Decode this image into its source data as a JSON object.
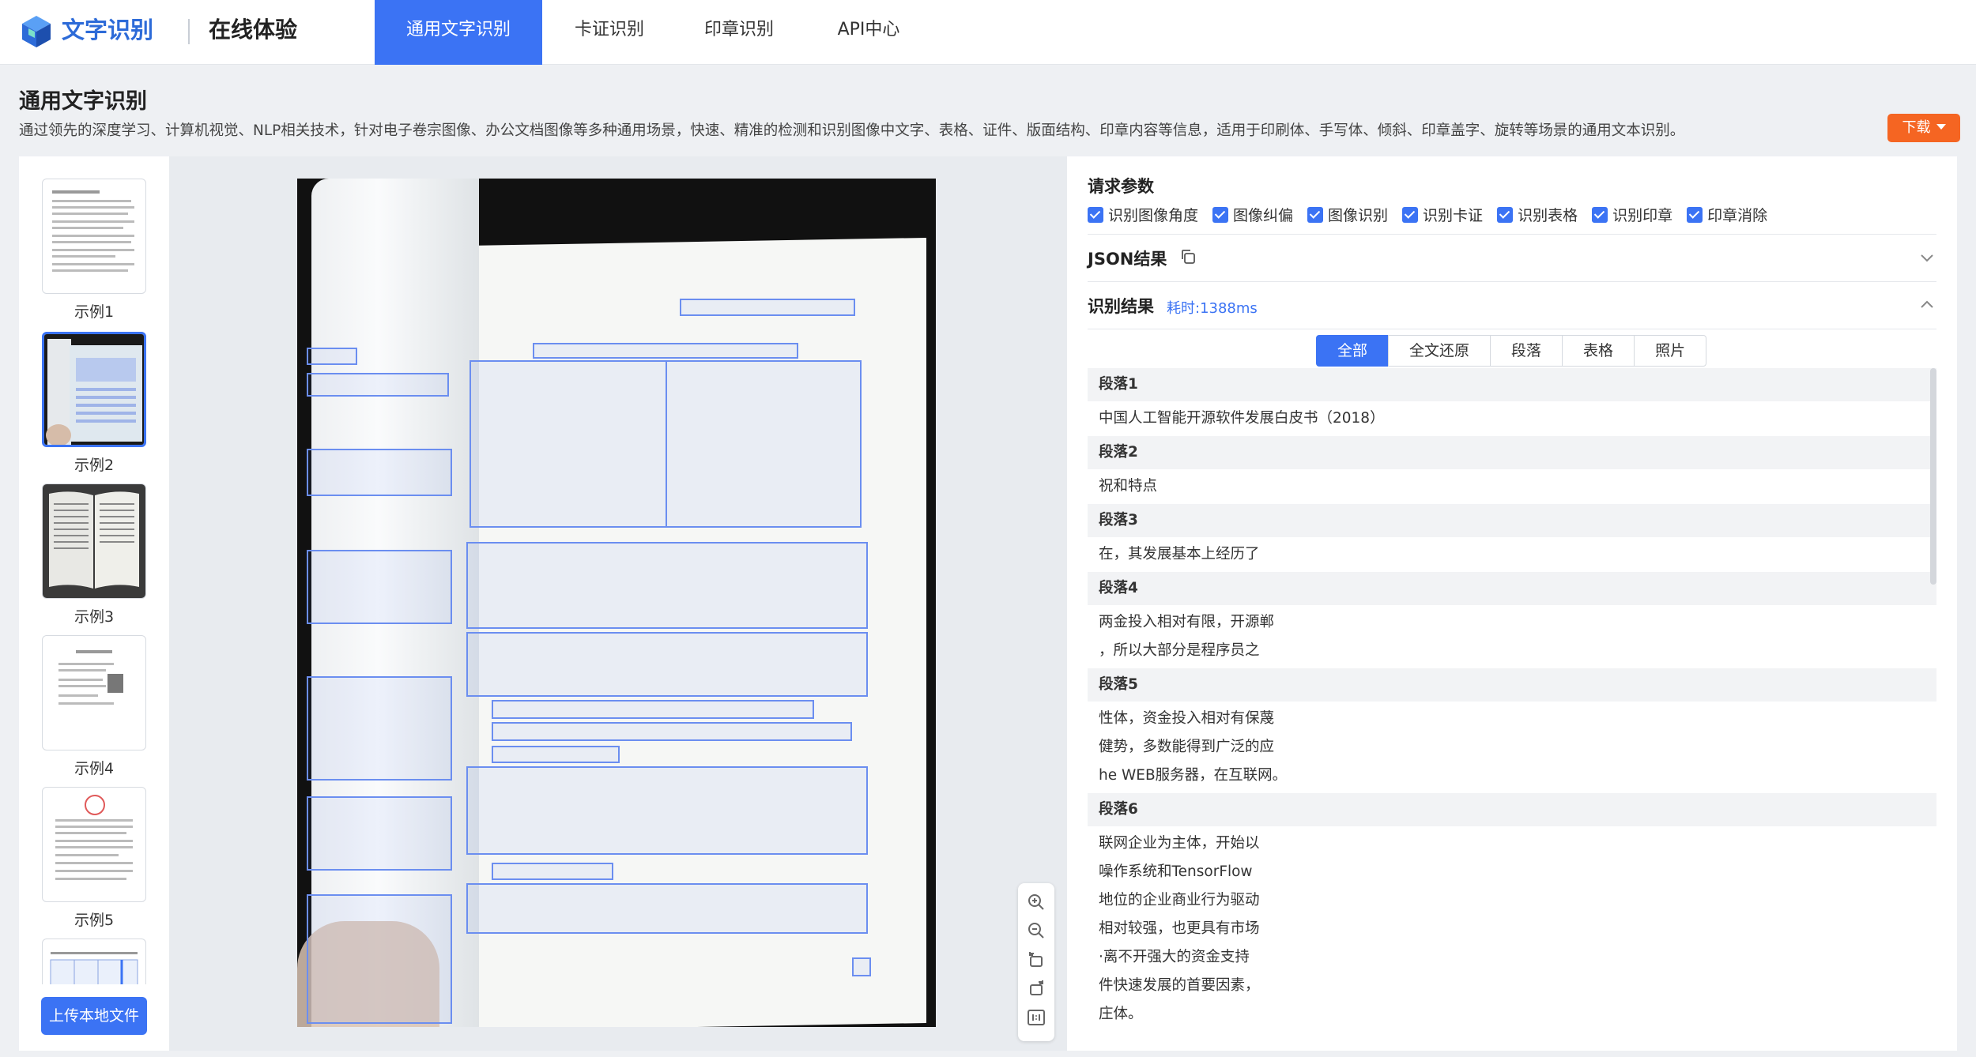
{
  "brand": {
    "name": "文字识别",
    "subtitle": "在线体验"
  },
  "nav": [
    {
      "label": "通用文字识别",
      "active": true
    },
    {
      "label": "卡证识别",
      "active": false
    },
    {
      "label": "印章识别",
      "active": false
    },
    {
      "label": "API中心",
      "active": false
    }
  ],
  "page": {
    "title": "通用文字识别",
    "description": "通过领先的深度学习、计算机视觉、NLP相关技术，针对电子卷宗图像、办公文档图像等多种通用场景，快速、精准的检测和识别图像中文字、表格、证件、版面结构、印章内容等信息，适用于印刷体、手写体、倾斜、印章盖字、旋转等场景的通用文本识别。",
    "download_label": "下载"
  },
  "samples": [
    {
      "label": "示例1",
      "active": false
    },
    {
      "label": "示例2",
      "active": true
    },
    {
      "label": "示例3",
      "active": false
    },
    {
      "label": "示例4",
      "active": false
    },
    {
      "label": "示例5",
      "active": false
    }
  ],
  "upload_label": "上传本地文件",
  "params": {
    "title": "请求参数",
    "options": [
      {
        "label": "识别图像角度",
        "checked": true
      },
      {
        "label": "图像纠偏",
        "checked": true
      },
      {
        "label": "图像识别",
        "checked": true
      },
      {
        "label": "识别卡证",
        "checked": true
      },
      {
        "label": "识别表格",
        "checked": true
      },
      {
        "label": "识别印章",
        "checked": true
      },
      {
        "label": "印章消除",
        "checked": true
      }
    ]
  },
  "json_section": {
    "title": "JSON结果"
  },
  "result_section": {
    "title": "识别结果",
    "elapsed": "耗时:1388ms",
    "tabs": [
      {
        "label": "全部",
        "active": true
      },
      {
        "label": "全文还原",
        "active": false
      },
      {
        "label": "段落",
        "active": false
      },
      {
        "label": "表格",
        "active": false
      },
      {
        "label": "照片",
        "active": false
      }
    ],
    "paragraphs": [
      {
        "title": "段落1",
        "lines": [
          "中国人工智能开源软件发展白皮书（2018）"
        ]
      },
      {
        "title": "段落2",
        "lines": [
          "祝和特点"
        ]
      },
      {
        "title": "段落3",
        "lines": [
          "在，其发展基本上经历了"
        ]
      },
      {
        "title": "段落4",
        "lines": [
          "两金投入相对有限，开源郸",
          "，所以大部分是程序员之"
        ]
      },
      {
        "title": "段落5",
        "lines": [
          "性体，资金投入相对有保蔑",
          "健势，多数能得到广泛的应",
          "he WEB服务器，在互联网。"
        ]
      },
      {
        "title": "段落6",
        "lines": [
          "联网企业为主体，开始以",
          "噪作系统和TensorFlow",
          "地位的企业商业行为驱动",
          "相对较强，也更具有市场",
          "·离不开强大的资金支持",
          "件快速发展的首要因素，",
          "庄体。"
        ]
      }
    ]
  },
  "colors": {
    "primary": "#3b73f4",
    "download": "#f56522"
  }
}
